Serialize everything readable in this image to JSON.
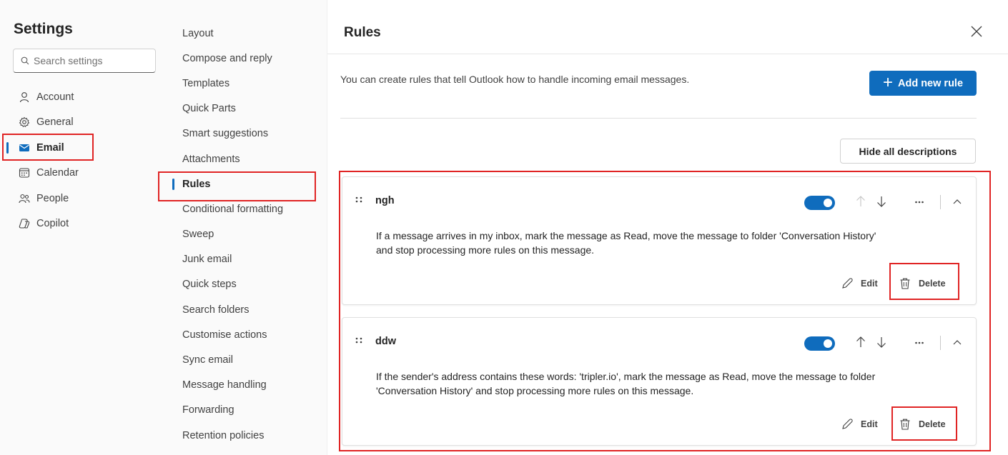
{
  "settings": {
    "title": "Settings",
    "search_placeholder": "Search settings",
    "nav": [
      {
        "label": "Account",
        "icon": "person-icon",
        "active": false
      },
      {
        "label": "General",
        "icon": "gear-icon",
        "active": false
      },
      {
        "label": "Email",
        "icon": "mail-icon",
        "active": true
      },
      {
        "label": "Calendar",
        "icon": "calendar-icon",
        "active": false
      },
      {
        "label": "People",
        "icon": "people-icon",
        "active": false
      },
      {
        "label": "Copilot",
        "icon": "copilot-icon",
        "active": false
      }
    ]
  },
  "email_nav": [
    "Layout",
    "Compose and reply",
    "Templates",
    "Quick Parts",
    "Smart suggestions",
    "Attachments",
    "Rules",
    "Conditional formatting",
    "Sweep",
    "Junk email",
    "Quick steps",
    "Search folders",
    "Customise actions",
    "Sync email",
    "Message handling",
    "Forwarding",
    "Retention policies"
  ],
  "email_nav_active": "Rules",
  "rules_page": {
    "title": "Rules",
    "intro": "You can create rules that tell Outlook how to handle incoming email messages.",
    "add_label": "Add new rule",
    "hide_label": "Hide all descriptions",
    "rules": [
      {
        "name": "ngh",
        "enabled": true,
        "description": "If a message arrives in my inbox, mark the message as Read, move the message to folder 'Conversation History' and stop processing more rules on this message.",
        "edit_label": "Edit",
        "delete_label": "Delete"
      },
      {
        "name": "ddw",
        "enabled": true,
        "description": "If the sender's address contains these words: 'tripler.io', mark the message as Read, move the message to folder 'Conversation History' and stop processing more rules on this message.",
        "edit_label": "Edit",
        "delete_label": "Delete"
      }
    ]
  },
  "colors": {
    "accent": "#0f6cbd",
    "highlight": "#e02424"
  }
}
